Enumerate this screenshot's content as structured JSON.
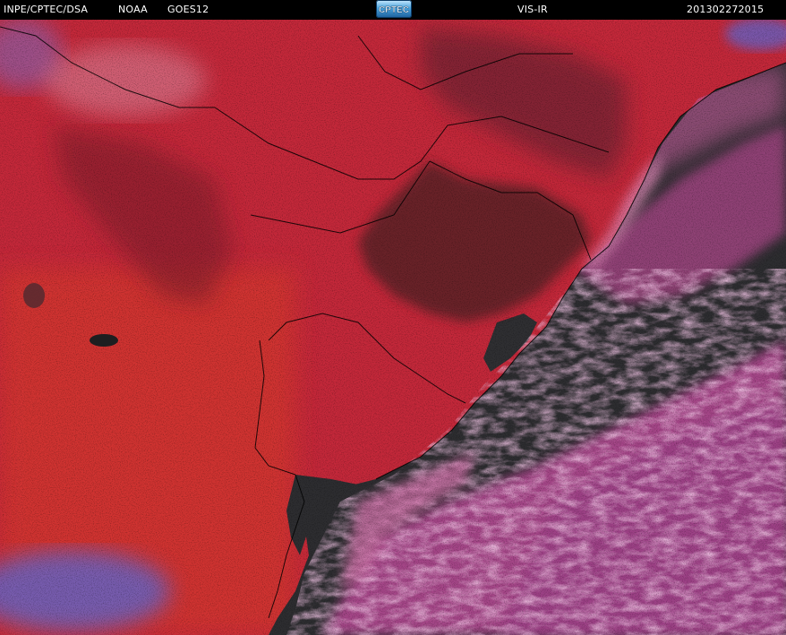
{
  "header": {
    "source": "INPE/CPTEC/DSA",
    "agency": "NOAA",
    "satellite": "GOES12",
    "logo_text": "CPTEC",
    "channel": "VIS-IR",
    "timestamp": "201302272015"
  },
  "colors": {
    "land_warm": "#c02a35",
    "land_dark": "#8a1e2a",
    "cloud_pink": "#c8509a",
    "cloud_light": "#e090c0",
    "ocean": "#2c2c2e",
    "high_cloud_blue": "#5a6ad8",
    "border_line": "#000000"
  }
}
